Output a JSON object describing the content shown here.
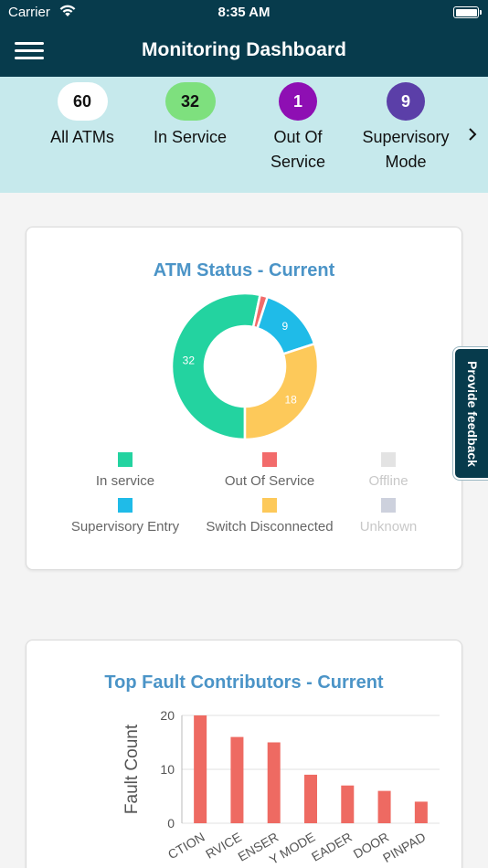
{
  "status_bar": {
    "carrier": "Carrier",
    "time": "8:35 AM"
  },
  "header": {
    "title": "Monitoring Dashboard"
  },
  "summary": {
    "items": [
      {
        "count": "60",
        "label": "All ATMs",
        "color": "#ffffff",
        "text_color": "#111111"
      },
      {
        "count": "32",
        "label": "In Service",
        "color": "#7ee07e",
        "text_color": "#111111"
      },
      {
        "count": "1",
        "label_1": "Out Of",
        "label_2": "Service",
        "color": "#8e0fb3",
        "text_color": "#ffffff"
      },
      {
        "count": "9",
        "label_1": "Supervisory",
        "label_2": "Mode",
        "color": "#5b3fa8",
        "text_color": "#ffffff"
      }
    ],
    "next_icon": "chevron-right-icon"
  },
  "status_card": {
    "title": "ATM Status - Current",
    "legend": [
      {
        "label": "In service",
        "color": "#23d3a0",
        "active": true
      },
      {
        "label": "Out Of Service",
        "color": "#f26b6b",
        "active": true
      },
      {
        "label": "Offline",
        "color": "#e3e3e3",
        "active": false
      },
      {
        "label": "Supervisory Entry",
        "color": "#1fbbe8",
        "active": true
      },
      {
        "label": "Switch Disconnected",
        "color": "#fdc95a",
        "active": true
      },
      {
        "label": "Unknown",
        "color": "#cdd1dd",
        "active": false
      }
    ]
  },
  "fault_card": {
    "title": "Top Fault Contributors - Current"
  },
  "feedback": {
    "label": "Provide feedback"
  },
  "chart_data": [
    {
      "type": "pie",
      "title": "ATM Status - Current",
      "labels": [
        "In service",
        "Out Of Service",
        "Supervisory Entry",
        "Switch Disconnected"
      ],
      "values": [
        32,
        1,
        9,
        18
      ],
      "data_labels": [
        "32",
        "",
        "9",
        "18"
      ],
      "colors": [
        "#23d3a0",
        "#f26b6b",
        "#1fbbe8",
        "#fdc95a"
      ],
      "donut": true
    },
    {
      "type": "bar",
      "title": "Top Fault Contributors - Current",
      "ylabel": "Fault Count",
      "ylim": [
        0,
        20
      ],
      "yticks": [
        "0",
        "10",
        "20"
      ],
      "categories": [
        "CTION",
        "RVICE",
        "ENSER",
        "Y MODE",
        "EADER",
        "DOOR",
        "PINPAD"
      ],
      "values": [
        20,
        16,
        15,
        9,
        7,
        6,
        4
      ],
      "color": "#ee6a62",
      "grid": true
    }
  ]
}
